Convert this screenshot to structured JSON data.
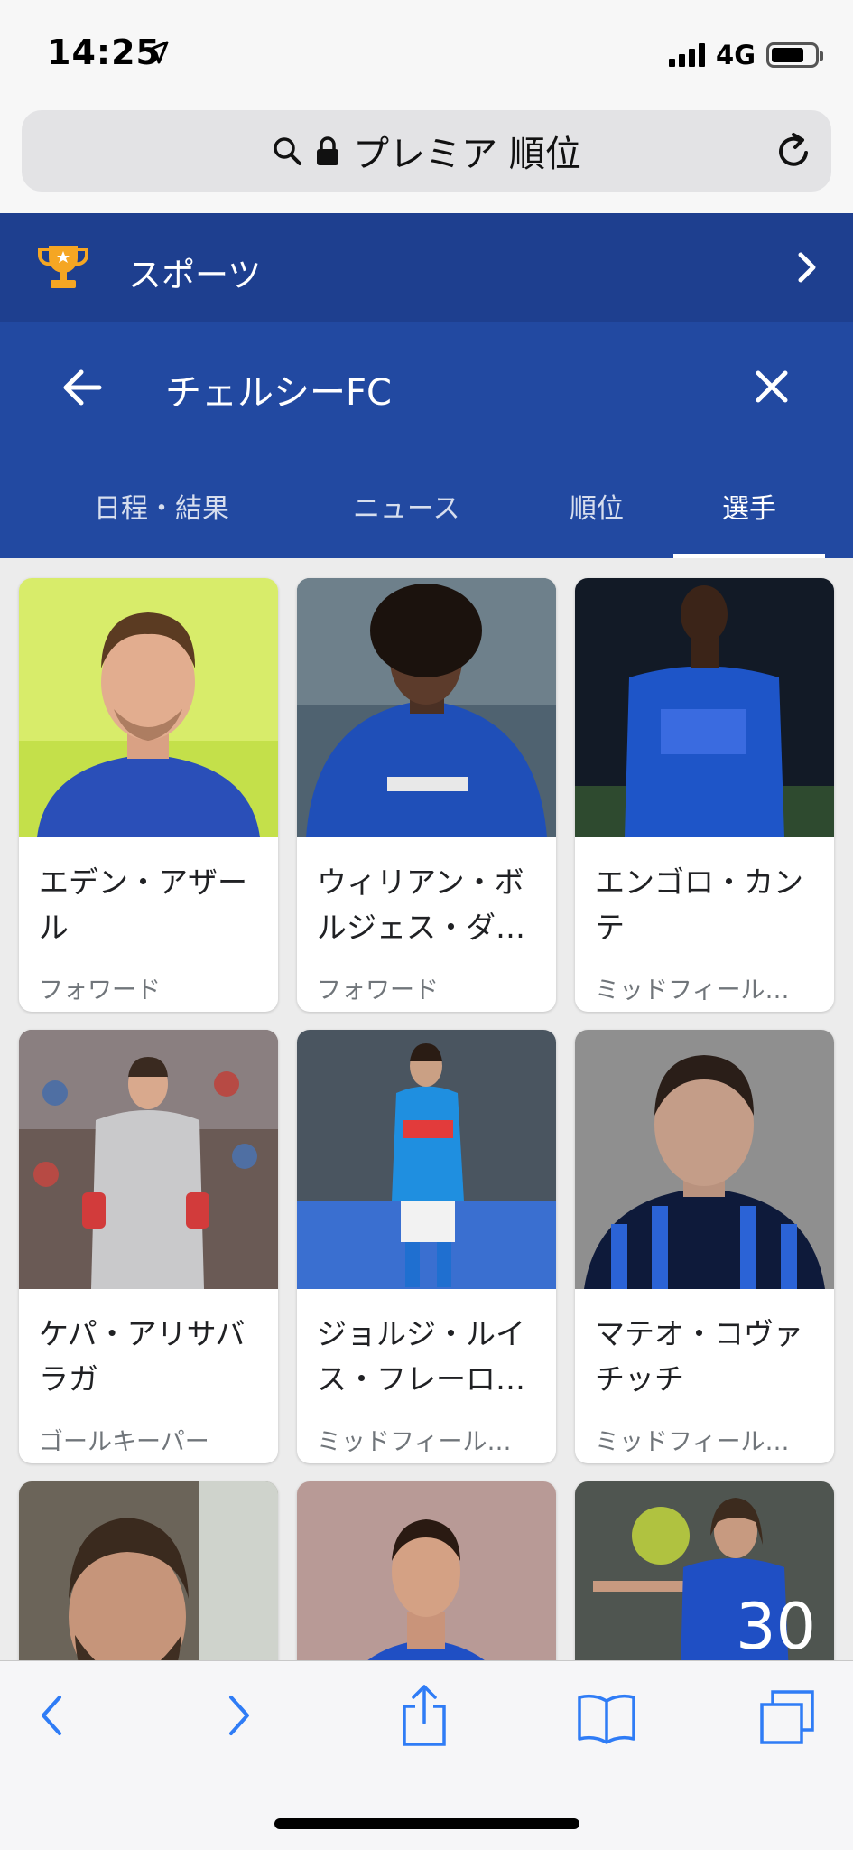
{
  "status_bar": {
    "time": "14:25",
    "network": "4G"
  },
  "url_bar": {
    "text": "プレミア 順位"
  },
  "sports_header": {
    "label": "スポーツ"
  },
  "team_header": {
    "team_name": "チェルシーFC",
    "tabs": [
      {
        "label": "日程・結果"
      },
      {
        "label": "ニュース"
      },
      {
        "label": "順位"
      },
      {
        "label": "選手",
        "active": true
      }
    ]
  },
  "players": [
    {
      "name": "エデン・アザール",
      "position": "フォワード"
    },
    {
      "name": "ウィリアン・ボルジェス・ダ…",
      "position": "フォワード"
    },
    {
      "name": "エンゴロ・カンテ",
      "position": "ミッドフィール…"
    },
    {
      "name": "ケパ・アリサバラガ",
      "position": "ゴールキーパー"
    },
    {
      "name": "ジョルジ・ルイス・フレーロ…",
      "position": "ミッドフィール…"
    },
    {
      "name": "マテオ・コヴァチッチ",
      "position": "ミッドフィール…"
    },
    {
      "name": "",
      "position": ""
    },
    {
      "name": "",
      "position": ""
    },
    {
      "name": "",
      "position": ""
    }
  ],
  "colors": {
    "sports_bar": "#1e3f8f",
    "team_header": "#2249a1",
    "toolbar_icon": "#2f7cf6",
    "trophy": "#f5a623"
  },
  "icons": {
    "toolbar": [
      "back-chevron-icon",
      "forward-chevron-icon",
      "share-icon",
      "bookmarks-icon",
      "tabs-icon"
    ]
  }
}
